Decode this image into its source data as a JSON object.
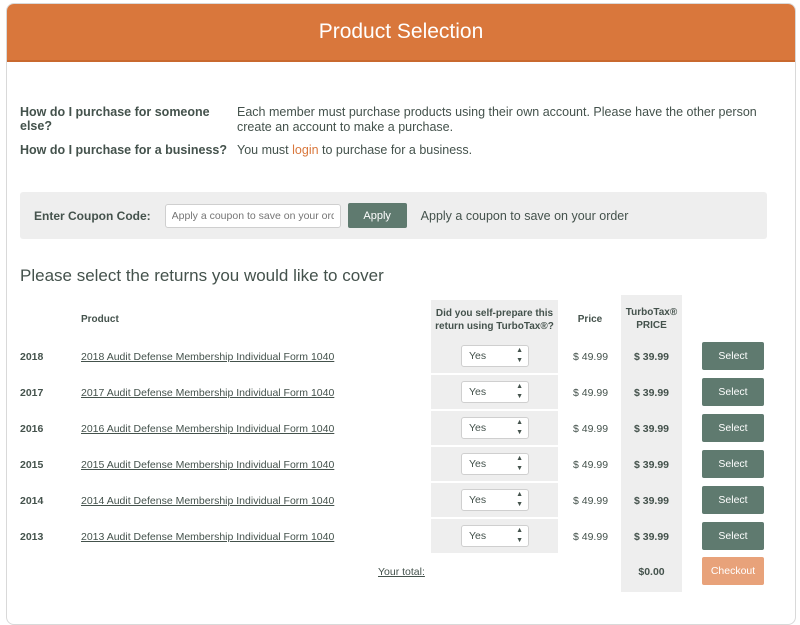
{
  "header": {
    "title": "Product Selection"
  },
  "faq": [
    {
      "question": "How do I purchase for someone else?",
      "answer": "Each member must purchase products using their own account. Please have the other person create an account to make a purchase."
    },
    {
      "question": "How do I purchase for a business?",
      "answer_prefix": "You must ",
      "answer_link": "login",
      "answer_suffix": " to purchase for a business."
    }
  ],
  "coupon": {
    "label": "Enter Coupon Code:",
    "placeholder": "Apply a coupon to save on your order",
    "button": "Apply",
    "hint": "Apply a coupon to save on your order"
  },
  "section_title": "Please select the returns you would like to cover",
  "table": {
    "headers": {
      "product": "Product",
      "self_prepare": "Did you self-prepare this return using TurboTax®?",
      "price": "Price",
      "turbotax_price": "TurboTax® PRICE"
    },
    "rows": [
      {
        "year": "2018",
        "product": "2018 Audit Defense Membership Individual Form 1040",
        "self_prepared": "Yes",
        "price": "$ 49.99",
        "turbotax_price": "$ 39.99",
        "button": "Select"
      },
      {
        "year": "2017",
        "product": "2017 Audit Defense Membership Individual Form 1040",
        "self_prepared": "Yes",
        "price": "$ 49.99",
        "turbotax_price": "$ 39.99",
        "button": "Select"
      },
      {
        "year": "2016",
        "product": "2016 Audit Defense Membership Individual Form 1040",
        "self_prepared": "Yes",
        "price": "$ 49.99",
        "turbotax_price": "$ 39.99",
        "button": "Select"
      },
      {
        "year": "2015",
        "product": "2015 Audit Defense Membership Individual Form 1040",
        "self_prepared": "Yes",
        "price": "$ 49.99",
        "turbotax_price": "$ 39.99",
        "button": "Select"
      },
      {
        "year": "2014",
        "product": "2014 Audit Defense Membership Individual Form 1040",
        "self_prepared": "Yes",
        "price": "$ 49.99",
        "turbotax_price": "$ 39.99",
        "button": "Select"
      },
      {
        "year": "2013",
        "product": "2013 Audit Defense Membership Individual Form 1040",
        "self_prepared": "Yes",
        "price": "$ 49.99",
        "turbotax_price": "$ 39.99",
        "button": "Select"
      }
    ],
    "total_label": "Your total:",
    "total_value": "$0.00",
    "checkout": "Checkout"
  },
  "colors": {
    "header": "#d9773c",
    "button": "#5f7a6f",
    "checkout": "#e8a27a",
    "link": "#d9773c",
    "panel": "#eeeeee"
  }
}
